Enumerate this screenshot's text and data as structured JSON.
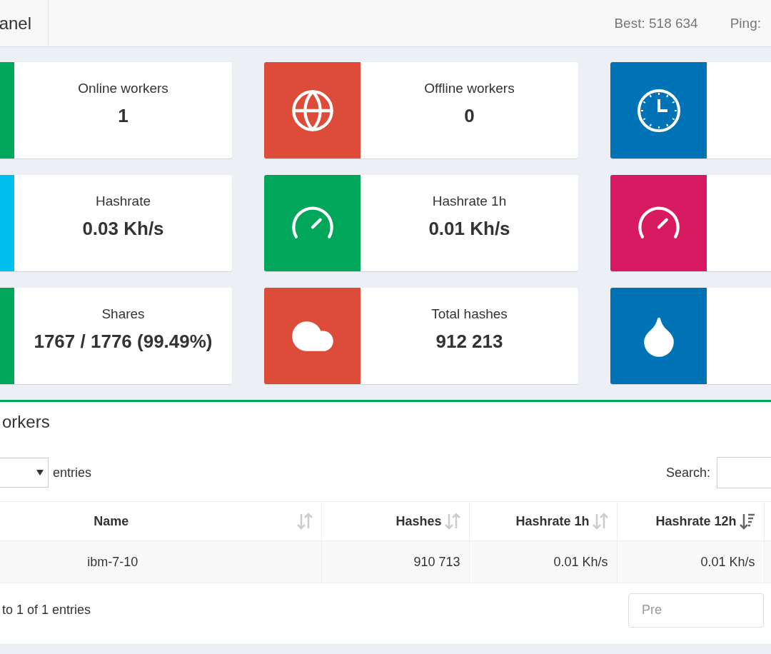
{
  "header": {
    "brand": "anel",
    "stats": [
      "Best: 518 634",
      "Ping:"
    ]
  },
  "cards": [
    {
      "color": "#00a65a",
      "label": "Online workers",
      "value": "1"
    },
    {
      "color": "#dd4b39",
      "kind": "globe",
      "label": "Offline workers",
      "value": "0"
    },
    {
      "color": "#0073b7",
      "kind": "clock"
    },
    {
      "color": "#00c0ef",
      "label": "Hashrate",
      "value": "0.03 Kh/s"
    },
    {
      "color": "#00a65a",
      "kind": "gauge",
      "label": "Hashrate 1h",
      "value": "0.01 Kh/s"
    },
    {
      "color": "#d81b60",
      "kind": "gauge"
    },
    {
      "color": "#00a65a",
      "label": "Shares",
      "value": "1767 / 1776 (99.49%)"
    },
    {
      "color": "#dd4b39",
      "kind": "cloud",
      "label": "Total hashes",
      "value": "912 213"
    },
    {
      "color": "#0073b7",
      "kind": "drop"
    }
  ],
  "workers": {
    "title": "orkers",
    "length_suffix": "entries",
    "search_label": "Search:",
    "columns": [
      {
        "label": "Name",
        "sorted": false
      },
      {
        "label": "Hashes",
        "sorted": false
      },
      {
        "label": "Hashrate 1h",
        "sorted": false
      },
      {
        "label": "Hashrate 12h",
        "sorted": true
      }
    ],
    "rows": [
      {
        "cells": [
          "ibm-7-10",
          "910 713",
          "0.01 Kh/s",
          "0.01 Kh/s"
        ]
      }
    ],
    "info": "to 1 of 1 entries",
    "pagination": [
      {
        "label": "Pre",
        "disabled": true
      }
    ]
  }
}
